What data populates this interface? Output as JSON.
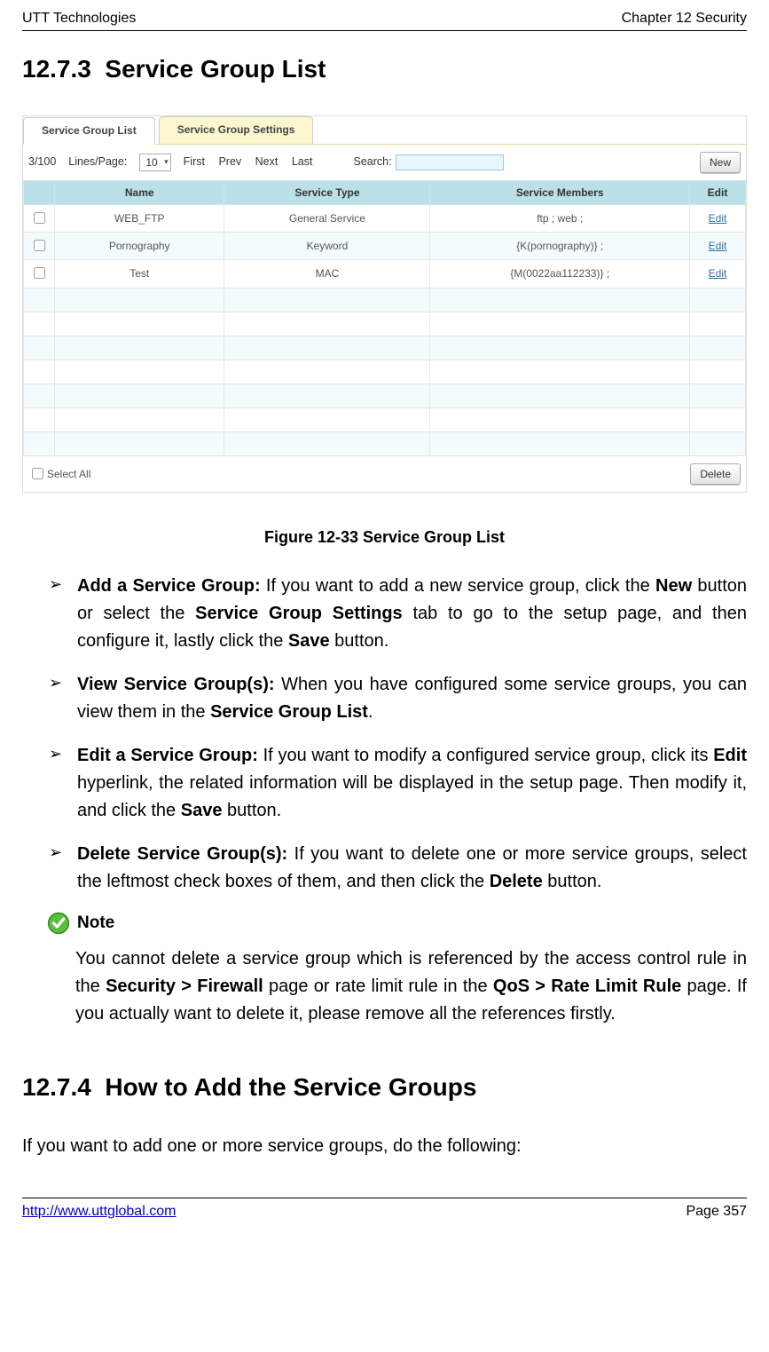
{
  "header": {
    "left": "UTT Technologies",
    "right": "Chapter 12 Security"
  },
  "section1": {
    "number": "12.7.3",
    "title": "Service Group List"
  },
  "screenshot": {
    "tabs": {
      "list": "Service Group List",
      "settings": "Service Group Settings"
    },
    "toolbar": {
      "count": "3/100",
      "lines_label": "Lines/Page:",
      "lines_value": "10",
      "first": "First",
      "prev": "Prev",
      "next": "Next",
      "last": "Last",
      "search_label": "Search:",
      "new_button": "New"
    },
    "columns": {
      "name": "Name",
      "type": "Service Type",
      "members": "Service Members",
      "edit": "Edit"
    },
    "rows": [
      {
        "name": "WEB_FTP",
        "type": "General Service",
        "members": "ftp ; web ;",
        "edit": "Edit"
      },
      {
        "name": "Pornography",
        "type": "Keyword",
        "members": "{K(pornography)} ;",
        "edit": "Edit"
      },
      {
        "name": "Test",
        "type": "MAC",
        "members": "{M(0022aa112233)} ;",
        "edit": "Edit"
      }
    ],
    "footer": {
      "select_all": "Select All",
      "delete_button": "Delete"
    }
  },
  "caption": "Figure 12-33 Service Group List",
  "bullets": {
    "b1": {
      "lead": "Add a Service Group:",
      "t1": " If you want to add a new service group, click the ",
      "k1": "New",
      "t2": " button or select the ",
      "k2": "Service Group Settings",
      "t3": " tab to go to the setup page, and then configure it, lastly click the ",
      "k3": "Save",
      "t4": " button."
    },
    "b2": {
      "lead": "View Service Group(s):",
      "t1": " When you have configured some service groups, you can view them in the ",
      "k1": "Service Group List",
      "t2": "."
    },
    "b3": {
      "lead": "Edit a Service Group:",
      "t1": " If you want to modify a configured service group, click its ",
      "k1": "Edit",
      "t2": " hyperlink, the related information will be displayed in the setup page. Then modify it, and click the ",
      "k2": "Save",
      "t3": " button."
    },
    "b4": {
      "lead": "Delete Service Group(s):",
      "t1": " If you want to delete one or more service groups, select the leftmost check boxes of them, and then click the ",
      "k1": "Delete",
      "t2": " button."
    }
  },
  "note": {
    "label": "Note",
    "t1": "You cannot delete a service group which is referenced by the access control rule in the ",
    "k1": "Security > Firewall",
    "t2": " page or rate limit rule in the ",
    "k2": "QoS > Rate Limit Rule",
    "t3": " page. If you actually want to delete it, please remove all the references firstly."
  },
  "section2": {
    "number": "12.7.4",
    "title": "How to Add the Service Groups"
  },
  "intro2": "If you want to add one or more service groups, do the following:",
  "footer": {
    "url": "http://www.uttglobal.com",
    "page": "Page 357"
  }
}
